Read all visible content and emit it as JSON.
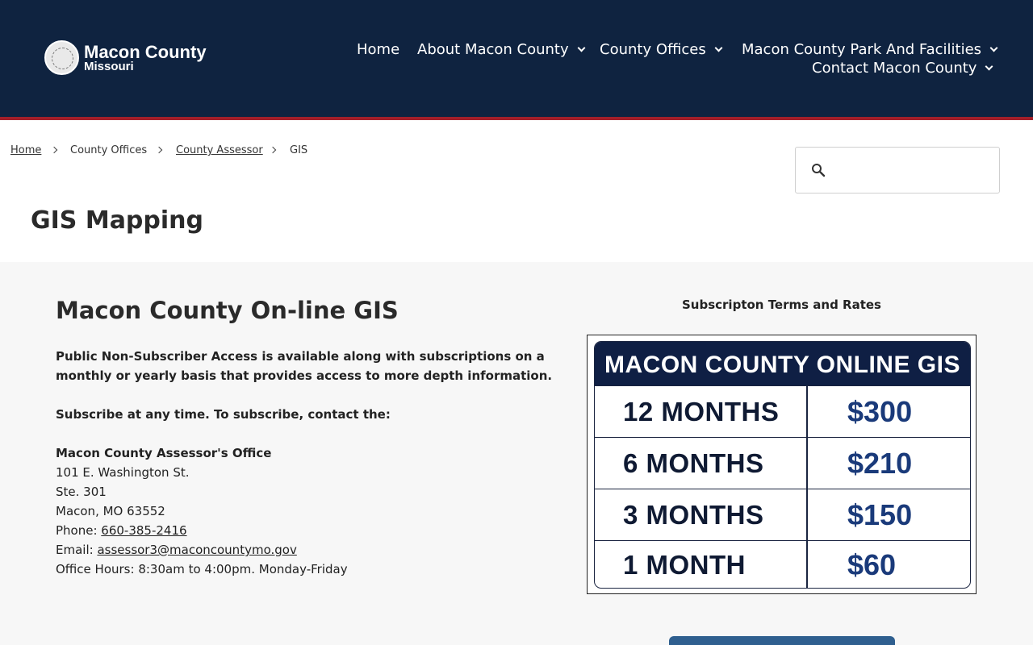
{
  "header": {
    "logo_title": "Macon County",
    "logo_subtitle": "Missouri",
    "nav": [
      {
        "label": "Home"
      },
      {
        "label": "About Macon County"
      },
      {
        "label": "County Offices"
      },
      {
        "label": "Macon County Park And Facilities"
      },
      {
        "label": "Contact Macon County"
      }
    ]
  },
  "breadcrumb": [
    "Home",
    "County Offices",
    "County Assessor",
    "GIS"
  ],
  "search": {
    "placeholder": "",
    "value": ""
  },
  "page_title": "GIS Mapping",
  "main": {
    "heading": "Macon County On-line GIS",
    "intro_line1": "Public Non-Subscriber Access is available along with subscriptions on a",
    "intro_line2": "monthly or yearly basis that provides access to more depth information.",
    "subscribe": "Subscribe at any time. To subscribe, contact the:",
    "office_name": "Macon County Assessor's Office",
    "address1": "101 E. Washington St.",
    "address2": "Ste. 301",
    "city": "Macon, MO 63552",
    "phone_label": "Phone: ",
    "phone": "660-385-2416",
    "email_label": "Email: ",
    "email": "assessor3@maconcountymo.gov",
    "hours": "Office Hours: 8:30am to 4:00pm. Monday-Friday"
  },
  "rates": {
    "section_title": "Subscripton Terms and Rates",
    "header": "MACON COUNTY ONLINE GIS",
    "rows": [
      {
        "term": "12 MONTHS",
        "price": "$300"
      },
      {
        "term": "6 MONTHS",
        "price": "$210"
      },
      {
        "term": "3 MONTHS",
        "price": "$150"
      },
      {
        "term": "1 MONTH",
        "price": "$60"
      }
    ]
  },
  "colors": {
    "header_bg": "#0f2340",
    "accent_rule": "#a31f2a",
    "content_bg": "#f7f7f7"
  }
}
